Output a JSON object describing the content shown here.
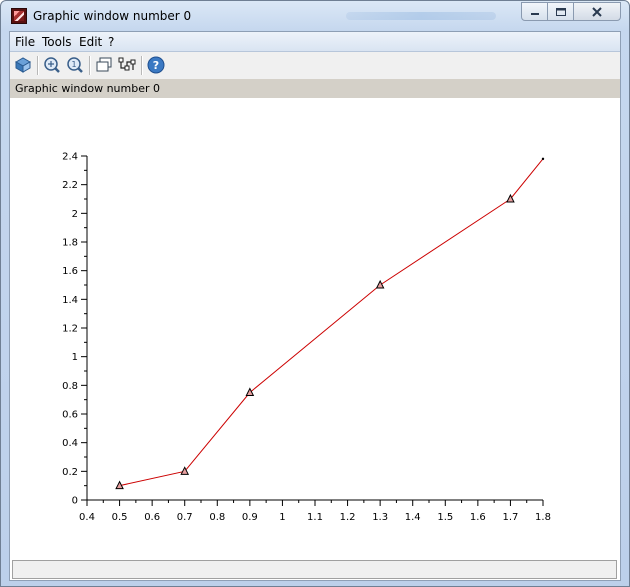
{
  "window": {
    "title": "Graphic window number 0",
    "colors": {
      "titlebar": "#c5d7ee",
      "frame": "#6f7f93"
    }
  },
  "menubar": {
    "items": [
      {
        "label": "File"
      },
      {
        "label": "Tools"
      },
      {
        "label": "Edit"
      },
      {
        "label": "?"
      }
    ]
  },
  "toolbar": {
    "buttons": [
      {
        "icon": "rotate-icon"
      },
      {
        "icon": "zoom-in-icon"
      },
      {
        "icon": "zoom-reset-icon"
      },
      {
        "icon": "datatip-icon"
      },
      {
        "icon": "edit-curve-icon"
      },
      {
        "icon": "help-icon"
      }
    ]
  },
  "infobar": {
    "text": "Graphic window number 0"
  },
  "statusbar": {
    "text": ""
  },
  "chart_data": {
    "type": "line",
    "title": "",
    "xlabel": "",
    "ylabel": "",
    "xlim": [
      0.4,
      1.8
    ],
    "ylim": [
      0,
      2.4
    ],
    "xticks": [
      "0.4",
      "0.5",
      "0.6",
      "0.7",
      "0.8",
      "0.9",
      "1",
      "1.1",
      "1.2",
      "1.3",
      "1.4",
      "1.5",
      "1.6",
      "1.7",
      "1.8"
    ],
    "yticks": [
      "0",
      "0.2",
      "0.4",
      "0.6",
      "0.8",
      "1",
      "1.2",
      "1.4",
      "1.6",
      "1.8",
      "2",
      "2.2",
      "2.4"
    ],
    "grid": false,
    "series": [
      {
        "color": "#cc0000",
        "marker": "triangle-up",
        "x": [
          0.5,
          0.7,
          0.9,
          1.3,
          1.7,
          1.8
        ],
        "y": [
          0.1,
          0.2,
          0.75,
          1.5,
          2.1,
          2.38
        ],
        "marked": [
          true,
          true,
          true,
          true,
          true,
          false
        ]
      }
    ]
  }
}
